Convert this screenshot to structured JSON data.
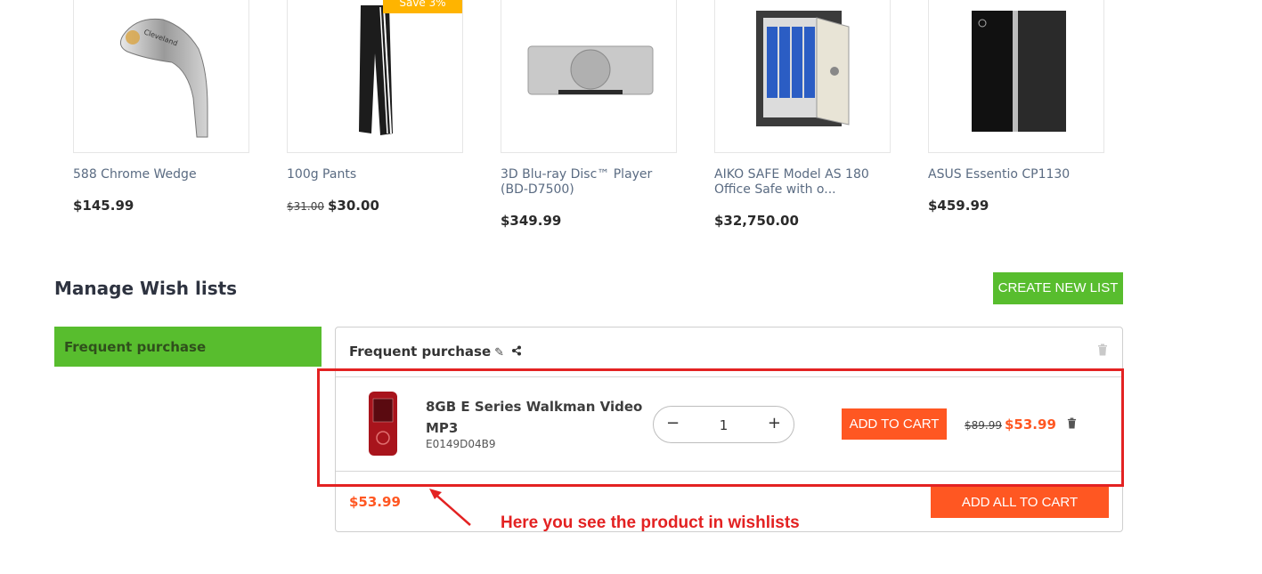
{
  "products": [
    {
      "name": "588 Chrome Wedge",
      "price": "$145.99",
      "old_price": "",
      "badge": "",
      "image": "golf-wedge"
    },
    {
      "name": "100g Pants",
      "price": "$30.00",
      "old_price": "$31.00",
      "badge": "Save 3%",
      "image": "track-pants"
    },
    {
      "name": "3D Blu-ray Disc™ Player (BD-D7500)",
      "price": "$349.99",
      "old_price": "",
      "badge": "",
      "image": "bluray-player"
    },
    {
      "name": "AIKO SAFE Model AS 180 Office Safe with o...",
      "price": "$32,750.00",
      "old_price": "",
      "badge": "",
      "image": "office-safe"
    },
    {
      "name": "ASUS Essentio CP1130",
      "price": "$459.99",
      "old_price": "",
      "badge": "",
      "image": "desktop-pc"
    }
  ],
  "wishlists": {
    "title": "Manage Wish lists",
    "create_button": "CREATE NEW LIST",
    "active_list": "Frequent purchase",
    "panel": {
      "title": "Frequent purchase",
      "icons": {
        "edit": "edit-icon",
        "share": "share-icon",
        "delete": "trash-icon"
      },
      "items": [
        {
          "name": "8GB E Series Walkman Video MP3",
          "sku": "E0149D04B9",
          "quantity": "1",
          "add_button": "ADD TO CART",
          "old_price": "$89.99",
          "price": "$53.99"
        }
      ],
      "total": "$53.99",
      "add_all_button": "ADD ALL TO CART"
    }
  },
  "annotation": {
    "text": "Here you see the product in wishlists",
    "color": "#e32222"
  },
  "colors": {
    "green": "#58bd2e",
    "orange": "#ff5722",
    "badge": "#ffb400"
  }
}
